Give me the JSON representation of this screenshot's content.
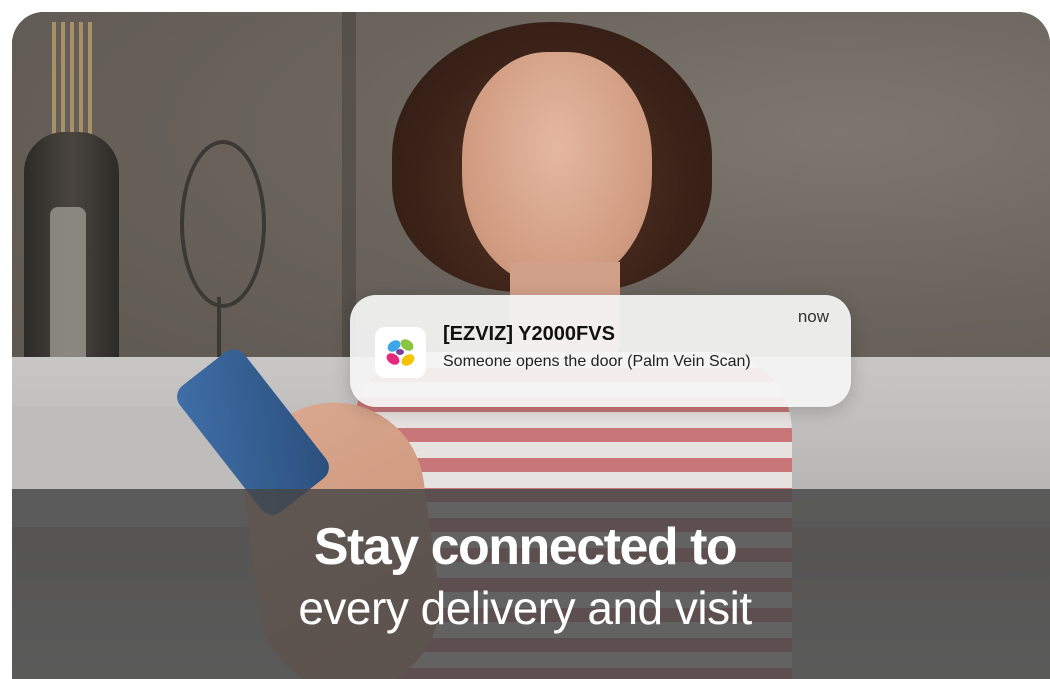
{
  "notification": {
    "app_name": "[EZVIZ] Y2000FVS",
    "message": "Someone opens the door (Palm Vein Scan)",
    "time": "now",
    "icon": "ezviz-app-icon"
  },
  "banner": {
    "headline": "Stay connected to",
    "subline": "every delivery and visit"
  },
  "colors": {
    "overlay": "#464646",
    "text": "#ffffff",
    "notification_bg": "#f5f5f5"
  }
}
